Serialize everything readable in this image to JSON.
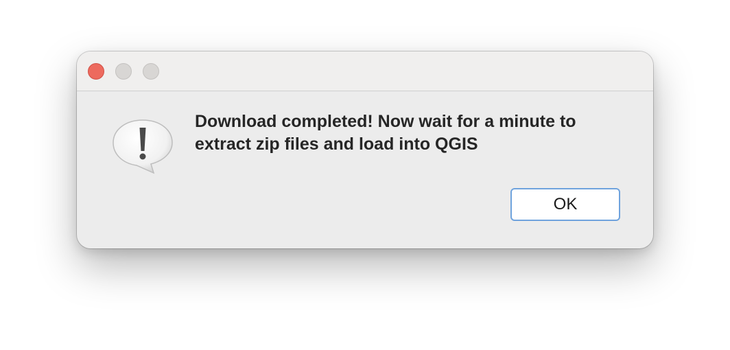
{
  "window": {
    "controls": {
      "close_color": "#ed6a5e",
      "minimize_color": "#d8d6d4",
      "zoom_color": "#d8d6d4"
    }
  },
  "alert": {
    "icon": "exclamation-bubble-icon",
    "message": "Download completed! Now wait for a minute to extract zip files and load into QGIS",
    "ok_label": "OK",
    "button_border_color": "#6fa3dd"
  }
}
